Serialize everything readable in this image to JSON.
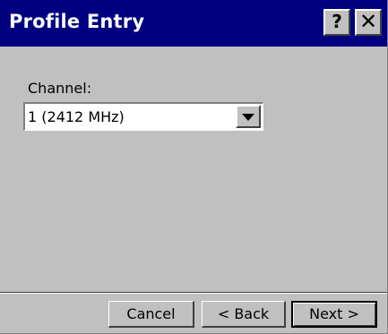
{
  "window": {
    "title": "Profile Entry",
    "help_label": "?",
    "close_label": "✕"
  },
  "form": {
    "channel_label": "Channel:",
    "channel_value": "1 (2412 MHz)"
  },
  "footer": {
    "cancel_label": "Cancel",
    "back_label": "< Back",
    "next_label": "Next >"
  },
  "colors": {
    "titlebar": "#000080",
    "face": "#c0c0c0"
  }
}
